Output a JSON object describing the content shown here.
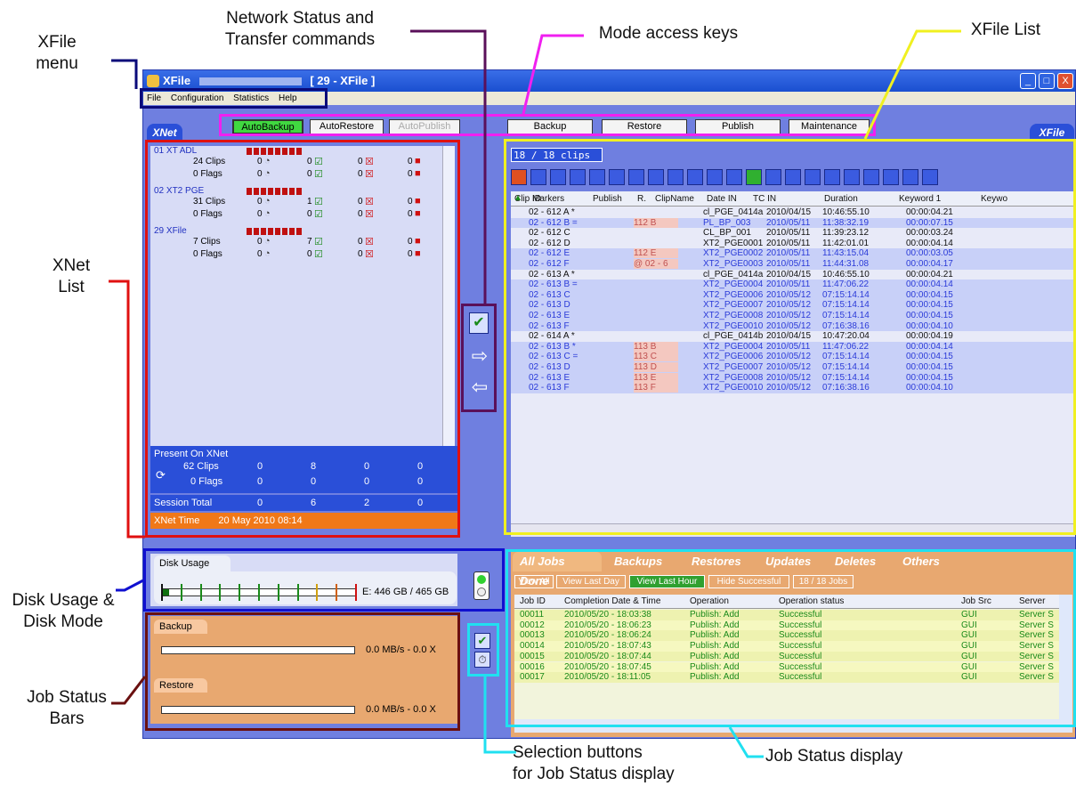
{
  "callouts": {
    "xfile_menu": "XFile\nmenu",
    "network_status": "Network Status and\nTransfer commands",
    "mode_keys": "Mode access keys",
    "xfile_list": "XFile List",
    "xnet_list": "XNet\nList",
    "disk_usage": "Disk Usage &\nDisk Mode",
    "job_bars": "Job Status\nBars",
    "selection_buttons": "Selection buttons\nfor Job Status display",
    "job_status_display": "Job Status display"
  },
  "window": {
    "title": "XFile",
    "title_suffix": "[ 29 - XFile ]",
    "menu": [
      "File",
      "Configuration",
      "Statistics",
      "Help"
    ]
  },
  "modes": [
    "AutoBackup",
    "AutoRestore",
    "AutoPublish",
    "Backup",
    "Restore",
    "Publish",
    "Maintenance"
  ],
  "xnet": {
    "badge": "XNet",
    "xfile_badge": "XFile",
    "groups": [
      {
        "name": "01 XT ADL",
        "clips": "24 Clips",
        "flags": "0 Flags",
        "a1": "0",
        "b1": "0",
        "c1": "0",
        "d1": "0",
        "a2": "0",
        "b2": "0",
        "c2": "0",
        "d2": "0"
      },
      {
        "name": "02 XT2 PGE",
        "clips": "31 Clips",
        "flags": "0 Flags",
        "a1": "0",
        "b1": "1",
        "c1": "0",
        "d1": "0",
        "a2": "0",
        "b2": "0",
        "c2": "0",
        "d2": "0"
      },
      {
        "name": "29 XFile",
        "clips": "7 Clips",
        "flags": "0 Flags",
        "a1": "0",
        "b1": "7",
        "c1": "0",
        "d1": "0",
        "a2": "0",
        "b2": "0",
        "c2": "0",
        "d2": "0"
      }
    ],
    "present_label": "Present On XNet",
    "present_clips": "62 Clips",
    "present_flags": "0 Flags",
    "present_vals": [
      "0",
      "8",
      "0",
      "0"
    ],
    "present_flag_vals": [
      "0",
      "0",
      "0",
      "0"
    ],
    "session_label": "Session Total",
    "session_vals": [
      "0",
      "6",
      "2",
      "0"
    ],
    "time_label": "XNet Time",
    "time_value": "20 May 2010   08:14"
  },
  "xfile_list": {
    "count": "18 / 18 clips",
    "columns": [
      "Clip ID",
      "Markers",
      "Publish",
      "R.",
      "ClipName",
      "Date IN",
      "TC IN",
      "Duration",
      "Keyword 1",
      "Keywo"
    ],
    "rows": [
      {
        "id": "02 - 612 A *",
        "pub": "",
        "name": "cl_PGE_0414a",
        "date": "2010/04/15",
        "tc": "10:46:55.10",
        "dur": "00:00:04.21",
        "hl": false
      },
      {
        "id": "02 - 612 B =",
        "pub": "112 B",
        "name": "PL_BP_003",
        "date": "2010/05/11",
        "tc": "11:38:32.19",
        "dur": "00:00:07.15",
        "hl": true
      },
      {
        "id": "02 - 612 C",
        "pub": "",
        "name": "CL_BP_001",
        "date": "2010/05/11",
        "tc": "11:39:23.12",
        "dur": "00:00:03.24",
        "hl": false
      },
      {
        "id": "02 - 612 D",
        "pub": "",
        "name": "XT2_PGE0001",
        "date": "2010/05/11",
        "tc": "11:42:01.01",
        "dur": "00:00:04.14",
        "hl": false
      },
      {
        "id": "02 - 612 E",
        "pub": "112 E",
        "name": "XT2_PGE0002",
        "date": "2010/05/11",
        "tc": "11:43:15.04",
        "dur": "00:00:03.05",
        "hl": true
      },
      {
        "id": "02 - 612 F",
        "pub": "@ 02 - 6",
        "name": "XT2_PGE0003",
        "date": "2010/05/11",
        "tc": "11:44:31.08",
        "dur": "00:00:04.17",
        "hl": true
      },
      {
        "id": "02 - 613 A *",
        "pub": "",
        "name": "cl_PGE_0414a",
        "date": "2010/04/15",
        "tc": "10:46:55.10",
        "dur": "00:00:04.21",
        "hl": false
      },
      {
        "id": "02 - 613 B =",
        "pub": "",
        "name": "XT2_PGE0004",
        "date": "2010/05/11",
        "tc": "11:47:06.22",
        "dur": "00:00:04.14",
        "hl": true
      },
      {
        "id": "02 - 613 C",
        "pub": "",
        "name": "XT2_PGE0006",
        "date": "2010/05/12",
        "tc": "07:15:14.14",
        "dur": "00:00:04.15",
        "hl": true
      },
      {
        "id": "02 - 613 D",
        "pub": "",
        "name": "XT2_PGE0007",
        "date": "2010/05/12",
        "tc": "07:15:14.14",
        "dur": "00:00:04.15",
        "hl": true
      },
      {
        "id": "02 - 613 E",
        "pub": "",
        "name": "XT2_PGE0008",
        "date": "2010/05/12",
        "tc": "07:15:14.14",
        "dur": "00:00:04.15",
        "hl": true
      },
      {
        "id": "02 - 613 F",
        "pub": "",
        "name": "XT2_PGE0010",
        "date": "2010/05/12",
        "tc": "07:16:38.16",
        "dur": "00:00:04.10",
        "hl": true
      },
      {
        "id": "02 - 614 A *",
        "pub": "",
        "name": "cl_PGE_0414b",
        "date": "2010/04/15",
        "tc": "10:47:20.04",
        "dur": "00:00:04.19",
        "hl": false
      },
      {
        "id": "02 - 613 B *",
        "pub": "113 B",
        "name": "XT2_PGE0004",
        "date": "2010/05/11",
        "tc": "11:47:06.22",
        "dur": "00:00:04.14",
        "hl": true
      },
      {
        "id": "02 - 613 C =",
        "pub": "113 C",
        "name": "XT2_PGE0006",
        "date": "2010/05/12",
        "tc": "07:15:14.14",
        "dur": "00:00:04.15",
        "hl": true
      },
      {
        "id": "02 - 613 D",
        "pub": "113 D",
        "name": "XT2_PGE0007",
        "date": "2010/05/12",
        "tc": "07:15:14.14",
        "dur": "00:00:04.15",
        "hl": true
      },
      {
        "id": "02 - 613 E",
        "pub": "113 E",
        "name": "XT2_PGE0008",
        "date": "2010/05/12",
        "tc": "07:15:14.14",
        "dur": "00:00:04.15",
        "hl": true
      },
      {
        "id": "02 - 613 F",
        "pub": "113 F",
        "name": "XT2_PGE0010",
        "date": "2010/05/12",
        "tc": "07:16:38.16",
        "dur": "00:00:04.10",
        "hl": true
      }
    ]
  },
  "disk": {
    "label": "Disk Usage",
    "value": "E: 446 GB / 465 GB"
  },
  "bars": {
    "backup_label": "Backup",
    "backup_value": "0.0 MB/s - 0.0 X",
    "restore_label": "Restore",
    "restore_value": "0.0 MB/s - 0.0 X"
  },
  "jobs": {
    "tabs": [
      "All Jobs Done",
      "Backups",
      "Restores",
      "Updates",
      "Deletes",
      "Others"
    ],
    "filters": [
      "View All",
      "View Last Day",
      "View Last Hour",
      "Hide Successful",
      "18 / 18 Jobs"
    ],
    "columns": [
      "Job ID",
      "Completion Date & Time",
      "Operation",
      "Operation status",
      "Job Src",
      "Server"
    ],
    "rows": [
      {
        "id": "00011",
        "date": "2010/05/20 - 18:03:38",
        "op": "Publish: Add",
        "status": "Successful",
        "src": "GUI",
        "server": "Server S"
      },
      {
        "id": "00012",
        "date": "2010/05/20 - 18:06:23",
        "op": "Publish: Add",
        "status": "Successful",
        "src": "GUI",
        "server": "Server S"
      },
      {
        "id": "00013",
        "date": "2010/05/20 - 18:06:24",
        "op": "Publish: Add",
        "status": "Successful",
        "src": "GUI",
        "server": "Server S"
      },
      {
        "id": "00014",
        "date": "2010/05/20 - 18:07:43",
        "op": "Publish: Add",
        "status": "Successful",
        "src": "GUI",
        "server": "Server S"
      },
      {
        "id": "00015",
        "date": "2010/05/20 - 18:07:44",
        "op": "Publish: Add",
        "status": "Successful",
        "src": "GUI",
        "server": "Server S"
      },
      {
        "id": "00016",
        "date": "2010/05/20 - 18:07:45",
        "op": "Publish: Add",
        "status": "Successful",
        "src": "GUI",
        "server": "Server S"
      },
      {
        "id": "00017",
        "date": "2010/05/20 - 18:11:05",
        "op": "Publish: Add",
        "status": "Successful",
        "src": "GUI",
        "server": "Server S"
      }
    ]
  }
}
